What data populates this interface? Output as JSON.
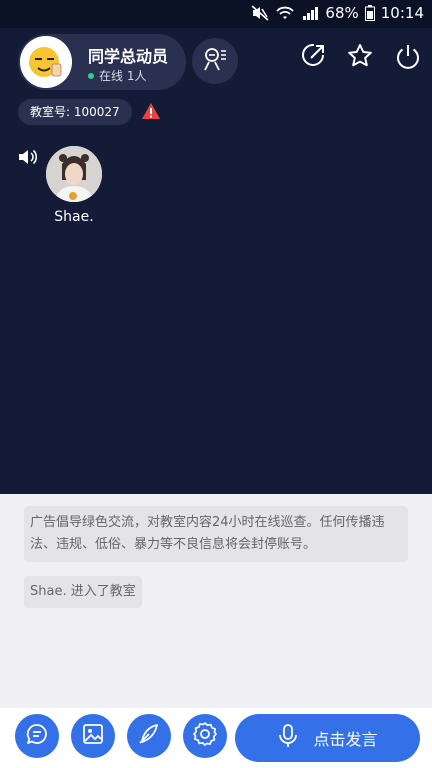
{
  "status_bar": {
    "battery": "68%",
    "time": "10:14",
    "icons": [
      "mute-icon",
      "wifi-icon",
      "signal-icon",
      "battery-icon"
    ]
  },
  "header": {
    "room_name": "同学总动员",
    "online": "在线 1人",
    "classroom_id": "教室号: 100027",
    "icons": [
      "presenter-icon",
      "share-icon",
      "star-icon",
      "power-icon",
      "warning-icon"
    ]
  },
  "members": [
    {
      "name": "Shae."
    }
  ],
  "chat": {
    "notice": "广告倡导绿色交流，对教室内容24小时在线巡查。任何传播违法、违规、低俗、暴力等不良信息将会封停账号。",
    "join_message": "Shae. 进入了教室"
  },
  "toolbar": {
    "speak_label": "点击发言",
    "icons": [
      "message-icon",
      "image-icon",
      "pen-icon",
      "settings-icon",
      "microphone-icon"
    ]
  },
  "colors": {
    "primary": "#3470e8",
    "dark_bg": "#141b37",
    "warning": "#e84343",
    "online": "#2bd08b"
  }
}
